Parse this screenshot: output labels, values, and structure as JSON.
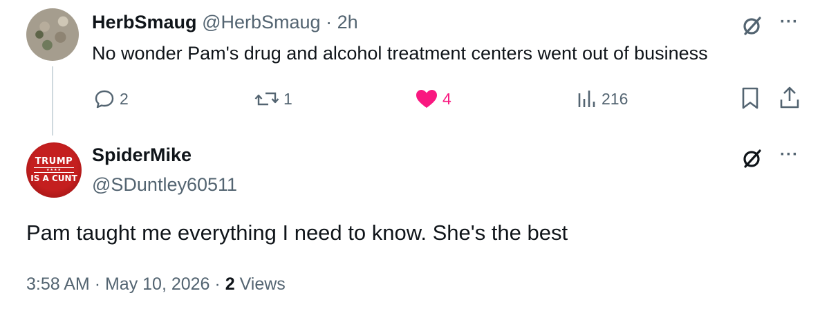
{
  "tweet1": {
    "display_name": "HerbSmaug",
    "handle": "@HerbSmaug",
    "separator": "·",
    "time": "2h",
    "text": "No wonder Pam's drug and alcohol treatment centers went out of business",
    "replies": "2",
    "retweets": "1",
    "likes": "4",
    "views": "216",
    "more": "···"
  },
  "tweet2": {
    "display_name": "SpiderMike",
    "handle": "@SDuntley60511",
    "avatar_text_top": "TRUMP",
    "avatar_stars": "★★★★",
    "avatar_text_bottom": "IS A CUNT",
    "text": "Pam taught me everything I need to know. She's the best",
    "time": "3:58 AM",
    "separator": "·",
    "date": "May 10, 2026",
    "views_count": "2",
    "views_label": "Views",
    "more": "···"
  },
  "colors": {
    "text_primary": "#0f1419",
    "text_secondary": "#536471",
    "like_active": "#f91880",
    "thread_line": "#cfd9de"
  },
  "icons": [
    "grok-icon",
    "more-icon",
    "reply-icon",
    "retweet-icon",
    "like-icon",
    "views-icon",
    "bookmark-icon",
    "share-icon"
  ]
}
